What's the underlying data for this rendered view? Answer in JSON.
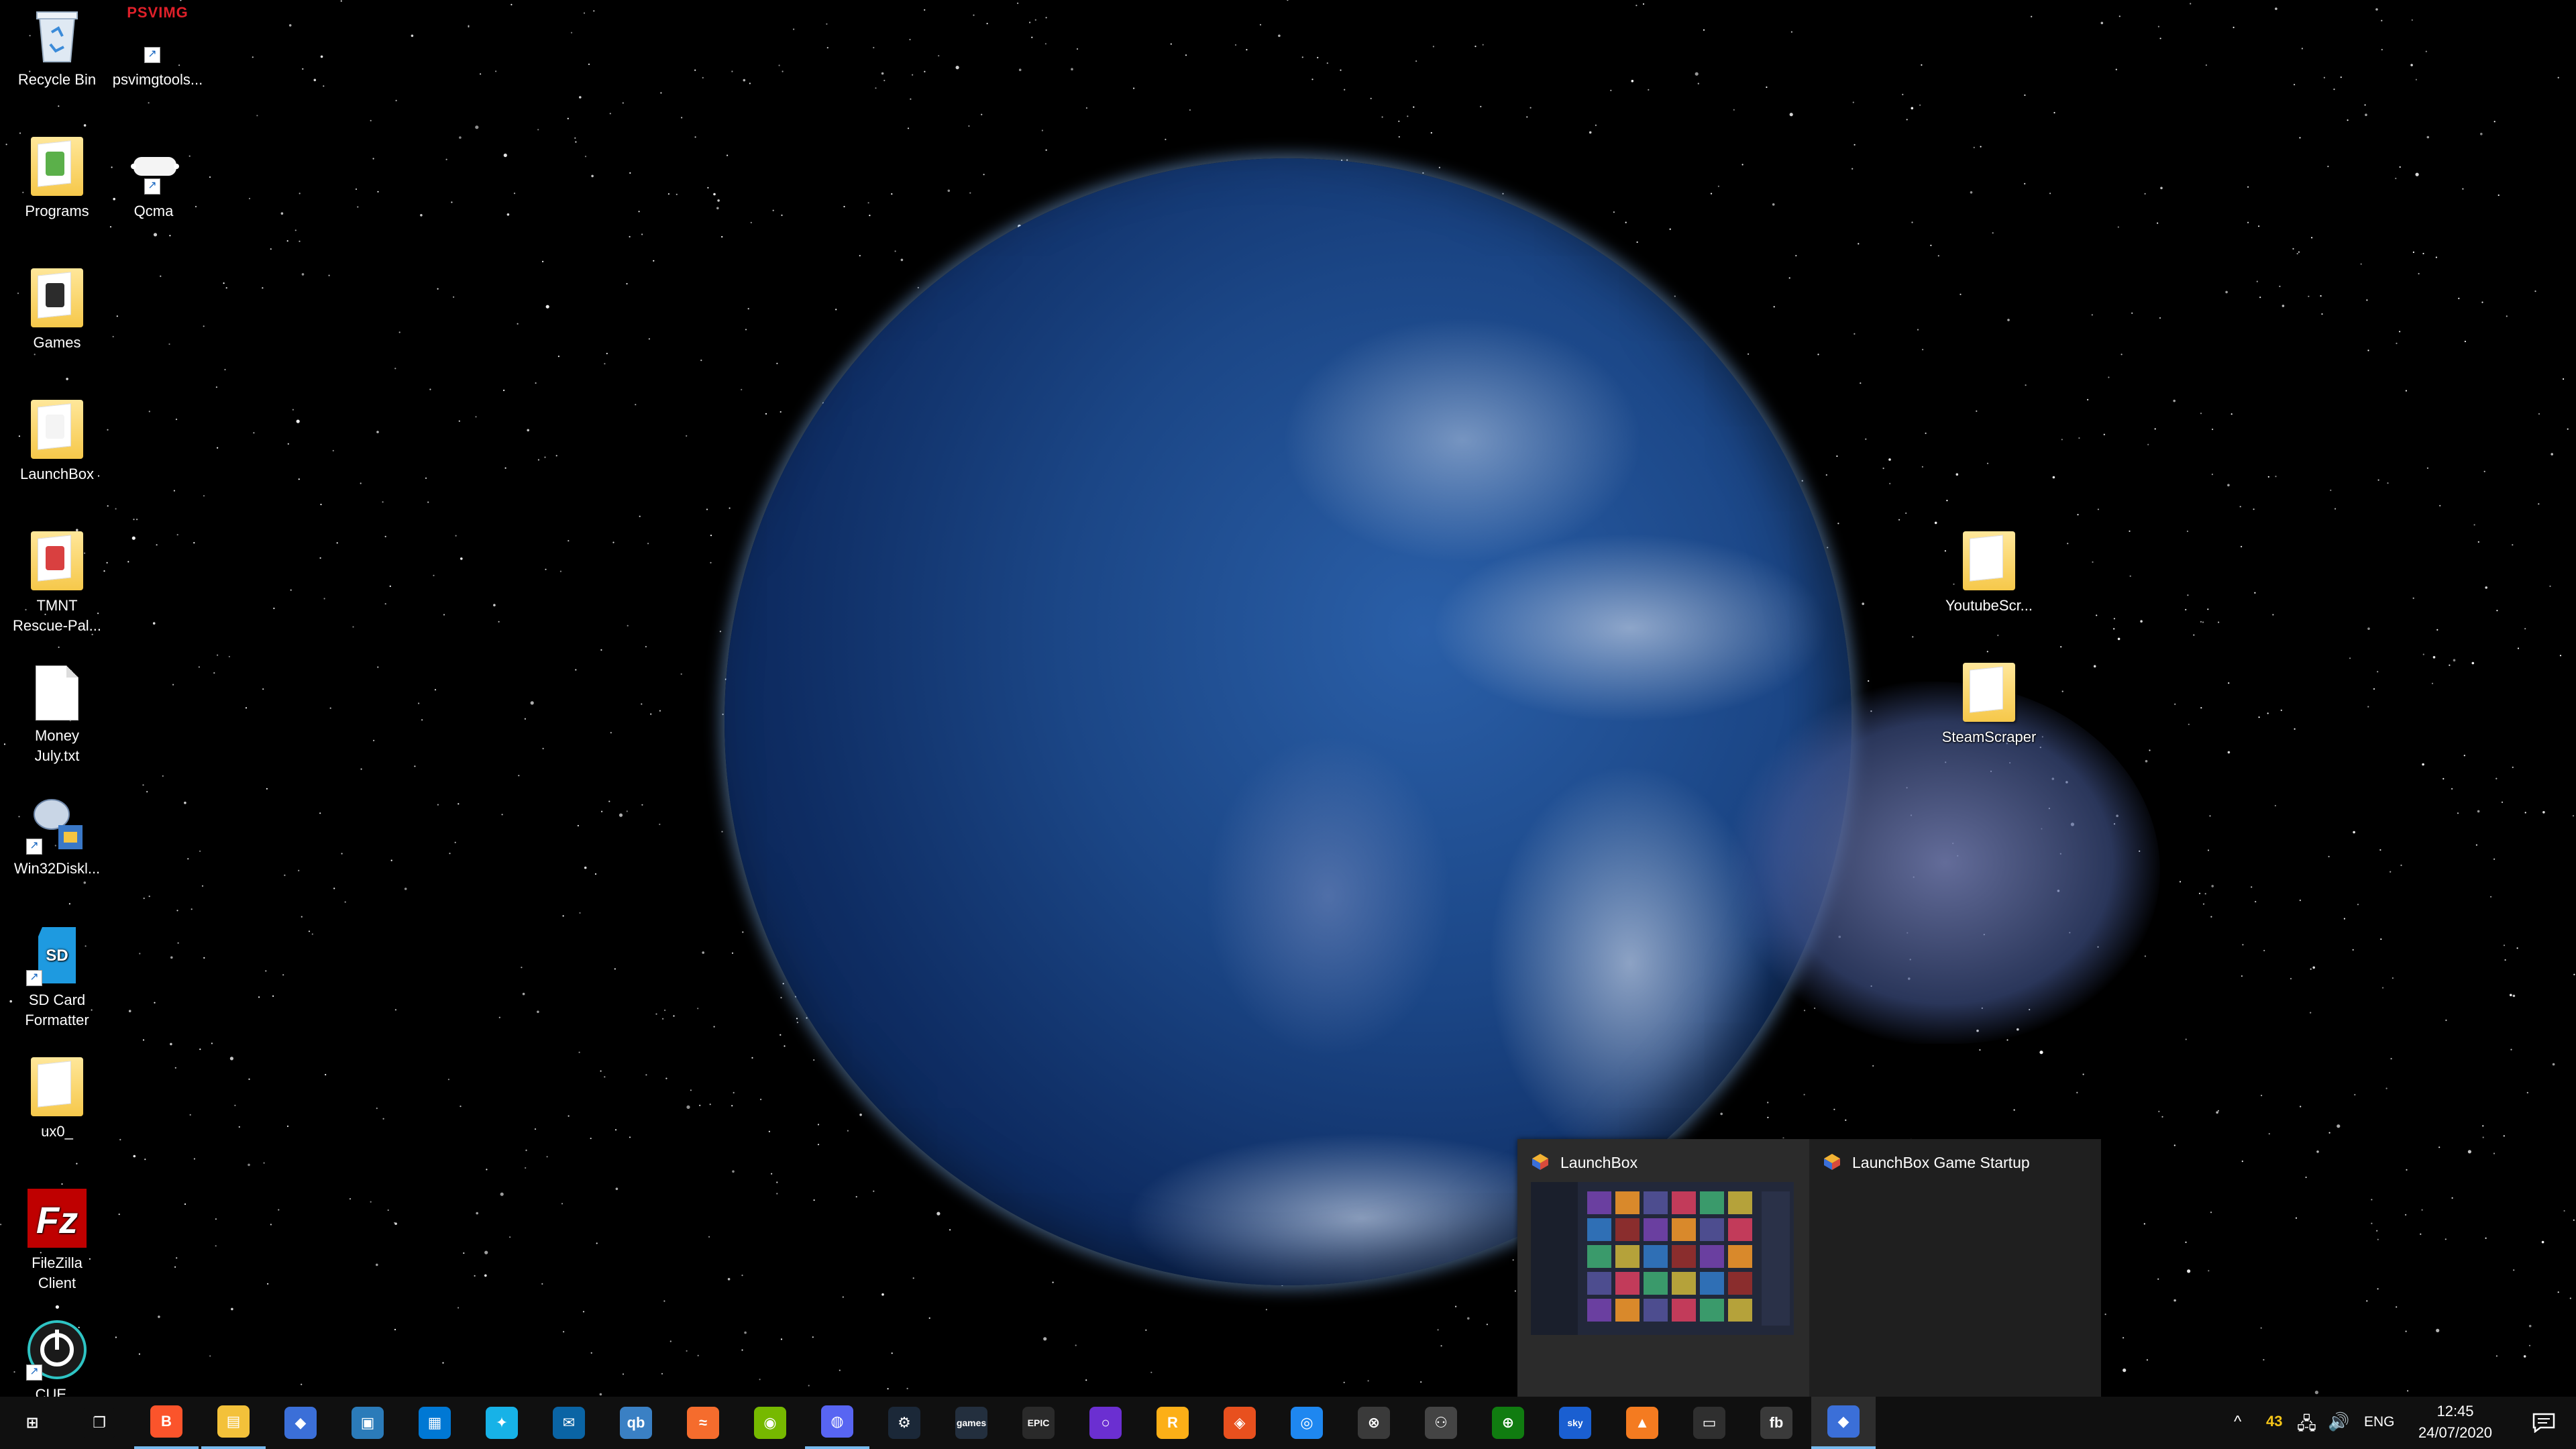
{
  "desktop": {
    "icons_left": [
      {
        "label": "Recycle Bin",
        "icon": "recycle-bin-icon"
      },
      {
        "label": "Programs",
        "icon": "folder-icon"
      },
      {
        "label": "Games",
        "icon": "folder-icon"
      },
      {
        "label": "LaunchBox",
        "icon": "folder-icon"
      },
      {
        "label": "TMNT Rescue-Pal...",
        "icon": "folder-icon"
      },
      {
        "label": "Money July.txt",
        "icon": "text-file-icon"
      },
      {
        "label": "Win32Diskl...",
        "icon": "disk-imager-icon"
      },
      {
        "label": "SD Card Formatter",
        "icon": "sd-card-icon"
      },
      {
        "label": "ux0_",
        "icon": "folder-icon"
      },
      {
        "label": "FileZilla Client",
        "icon": "filezilla-icon"
      },
      {
        "label": "CUE...",
        "icon": "icue-icon"
      }
    ],
    "icons_col2": [
      {
        "label": "psvimgtools...",
        "icon": "psvimg-icon",
        "logo_text": "PSVIMG"
      },
      {
        "label": "Qcma",
        "icon": "qcma-icon"
      }
    ],
    "icons_right": [
      {
        "label": "YoutubeScr...",
        "icon": "folder-icon"
      },
      {
        "label": "SteamScraper",
        "icon": "folder-icon"
      }
    ]
  },
  "thumbnail_popup": {
    "windows": [
      {
        "title": "LaunchBox"
      },
      {
        "title": "LaunchBox Game Startup"
      }
    ]
  },
  "taskbar": {
    "apps": [
      {
        "name": "start-button",
        "glyph": "⊞",
        "color": "#101010"
      },
      {
        "name": "task-view-button",
        "glyph": "❐",
        "color": "#101010"
      },
      {
        "name": "brave-browser",
        "glyph": "B",
        "color": "#fb542b"
      },
      {
        "name": "file-explorer",
        "glyph": "▤",
        "color": "#f3c13a"
      },
      {
        "name": "launchbox",
        "glyph": "◆",
        "color": "#3b6fd8"
      },
      {
        "name": "virtualbox",
        "glyph": "▣",
        "color": "#2b7bb9"
      },
      {
        "name": "microsoft-store",
        "glyph": "▦",
        "color": "#0078d4"
      },
      {
        "name": "kodi",
        "glyph": "✦",
        "color": "#17b2e7"
      },
      {
        "name": "mail",
        "glyph": "✉",
        "color": "#0a64a4"
      },
      {
        "name": "qbittorrent",
        "glyph": "qb",
        "color": "#3a80c4"
      },
      {
        "name": "origin",
        "glyph": "≈",
        "color": "#f56c2d"
      },
      {
        "name": "nvidia-geforce",
        "glyph": "◉",
        "color": "#76b900"
      },
      {
        "name": "discord",
        "glyph": "◍",
        "color": "#5865f2"
      },
      {
        "name": "steam",
        "glyph": "⚙",
        "color": "#1b2838"
      },
      {
        "name": "amazon-games",
        "glyph": "games",
        "color": "#232f3e"
      },
      {
        "name": "epic-games",
        "glyph": "EPIC",
        "color": "#2a2a2a"
      },
      {
        "name": "cortana",
        "glyph": "○",
        "color": "#6b2fd1"
      },
      {
        "name": "rockstar-launcher",
        "glyph": "R",
        "color": "#fcaf17"
      },
      {
        "name": "location-app",
        "glyph": "◈",
        "color": "#e8501e"
      },
      {
        "name": "ubisoft-connect",
        "glyph": "◎",
        "color": "#1e87f0"
      },
      {
        "name": "xbox",
        "glyph": "⊗",
        "color": "#3a3a3a"
      },
      {
        "name": "game-controller-app",
        "glyph": "⚇",
        "color": "#444444"
      },
      {
        "name": "xbox-console-companion",
        "glyph": "⊕",
        "color": "#107c10"
      },
      {
        "name": "sky-go",
        "glyph": "sky",
        "color": "#1a5fd1"
      },
      {
        "name": "vlc",
        "glyph": "▲",
        "color": "#f47b20"
      },
      {
        "name": "oculus",
        "glyph": "▭",
        "color": "#2f2f2f"
      },
      {
        "name": "fb-app",
        "glyph": "fb",
        "color": "#3a3a3a"
      },
      {
        "name": "launchbox-running",
        "glyph": "◆",
        "color": "#3b6fd8"
      }
    ],
    "tray": {
      "overflow": "^",
      "badge": "43",
      "language": "ENG",
      "time": "12:45",
      "date": "24/07/2020"
    },
    "colors": {
      "accent": "#76b9ed",
      "background": "#101010"
    }
  }
}
